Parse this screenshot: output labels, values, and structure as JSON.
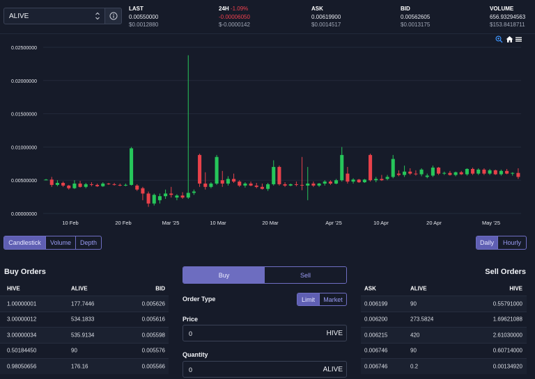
{
  "token": {
    "selected": "ALIVE"
  },
  "stats": [
    {
      "label": "LAST",
      "value": "0.00550000",
      "usd": "$0.0012880"
    },
    {
      "label": "24H",
      "change_pct": "-1.09%",
      "value": "-0.00006050",
      "usd": "$-0.0000142"
    },
    {
      "label": "ASK",
      "value": "0.00619900",
      "usd": "$0.0014517"
    },
    {
      "label": "BID",
      "value": "0.00562605",
      "usd": "$0.0013175"
    },
    {
      "label": "VOLUME",
      "value": "656.93294563",
      "usd": "$153.8418711"
    }
  ],
  "chart_data": {
    "type": "candlestick",
    "y_ticks": [
      "0.02500000",
      "0.02000000",
      "0.01500000",
      "0.01000000",
      "0.00500000",
      "0.00000000"
    ],
    "ylim": [
      0,
      0.025
    ],
    "x_ticks": [
      "10 Feb",
      "20 Feb",
      "Mar '25",
      "10 Mar",
      "20 Mar",
      "Apr '25",
      "10 Apr",
      "20 Apr",
      "May '25"
    ],
    "colors": {
      "up": "#26c65a",
      "down": "#e8414a"
    },
    "candles": [
      [
        0.005,
        0.0052,
        0.005,
        0.0051
      ],
      [
        0.0051,
        0.0055,
        0.004,
        0.0043
      ],
      [
        0.0043,
        0.005,
        0.0041,
        0.0046
      ],
      [
        0.0046,
        0.0048,
        0.004,
        0.0042
      ],
      [
        0.0042,
        0.0043,
        0.0036,
        0.0038
      ],
      [
        0.0038,
        0.005,
        0.0037,
        0.0045
      ],
      [
        0.0045,
        0.0049,
        0.0039,
        0.004
      ],
      [
        0.004,
        0.0046,
        0.0038,
        0.0044
      ],
      [
        0.0044,
        0.0047,
        0.0041,
        0.0043
      ],
      [
        0.0043,
        0.0045,
        0.004,
        0.0041
      ],
      [
        0.0041,
        0.0047,
        0.004,
        0.0045
      ],
      [
        0.0045,
        0.0046,
        0.0043,
        0.0044
      ],
      [
        0.0044,
        0.0046,
        0.0042,
        0.0043
      ],
      [
        0.0043,
        0.0045,
        0.0041,
        0.0042
      ],
      [
        0.0042,
        0.0045,
        0.0041,
        0.0043
      ],
      [
        0.0043,
        0.01,
        0.0042,
        0.0098
      ],
      [
        0.0042,
        0.0044,
        0.0034,
        0.0036
      ],
      [
        0.0038,
        0.004,
        0.002,
        0.003
      ],
      [
        0.003,
        0.0033,
        0.001,
        0.0015
      ],
      [
        0.0015,
        0.003,
        0.0012,
        0.0028
      ],
      [
        0.002,
        0.003,
        0.0015,
        0.0026
      ],
      [
        0.0026,
        0.0036,
        0.0022,
        0.003
      ],
      [
        0.003,
        0.004,
        0.0024,
        0.0028
      ],
      [
        0.0024,
        0.0029,
        0.002,
        0.0027
      ],
      [
        0.0027,
        0.0032,
        0.0022,
        0.0024
      ],
      [
        0.0024,
        0.0238,
        0.0022,
        0.0031
      ],
      [
        0.0031,
        0.0036,
        0.0028,
        0.0033
      ],
      [
        0.0088,
        0.009,
        0.004,
        0.0045
      ],
      [
        0.0045,
        0.0062,
        0.0036,
        0.004
      ],
      [
        0.004,
        0.0047,
        0.0038,
        0.0045
      ],
      [
        0.0045,
        0.0088,
        0.0043,
        0.0085
      ],
      [
        0.005,
        0.0064,
        0.004,
        0.0045
      ],
      [
        0.0045,
        0.0056,
        0.0042,
        0.0052
      ],
      [
        0.0052,
        0.006,
        0.0046,
        0.0048
      ],
      [
        0.0048,
        0.005,
        0.004,
        0.0042
      ],
      [
        0.0042,
        0.0047,
        0.0039,
        0.0045
      ],
      [
        0.0045,
        0.0048,
        0.0041,
        0.0042
      ],
      [
        0.0042,
        0.0046,
        0.0038,
        0.004
      ],
      [
        0.004,
        0.0045,
        0.0036,
        0.0037
      ],
      [
        0.0037,
        0.0046,
        0.0034,
        0.0044
      ],
      [
        0.0044,
        0.008,
        0.0042,
        0.007
      ],
      [
        0.007,
        0.0072,
        0.0042,
        0.0044
      ],
      [
        0.0044,
        0.0047,
        0.004,
        0.0042
      ],
      [
        0.0042,
        0.0045,
        0.0041,
        0.0044
      ],
      [
        0.0044,
        0.0048,
        0.0041,
        0.0043
      ],
      [
        0.0043,
        0.0085,
        0.0035,
        0.0042
      ],
      [
        0.0042,
        0.007,
        0.002,
        0.0045
      ],
      [
        0.0045,
        0.0048,
        0.004,
        0.0042
      ],
      [
        0.0042,
        0.0046,
        0.004,
        0.0045
      ],
      [
        0.0045,
        0.005,
        0.0042,
        0.0048
      ],
      [
        0.0048,
        0.005,
        0.0043,
        0.0045
      ],
      [
        0.0045,
        0.0052,
        0.0044,
        0.005
      ],
      [
        0.005,
        0.01,
        0.0048,
        0.0088
      ],
      [
        0.006,
        0.007,
        0.0045,
        0.0048
      ],
      [
        0.0048,
        0.0053,
        0.0045,
        0.0051
      ],
      [
        0.0051,
        0.0052,
        0.0046,
        0.0047
      ],
      [
        0.0047,
        0.0052,
        0.0046,
        0.0051
      ],
      [
        0.0088,
        0.009,
        0.0048,
        0.005
      ],
      [
        0.005,
        0.0055,
        0.0047,
        0.0052
      ],
      [
        0.0052,
        0.0058,
        0.0049,
        0.005
      ],
      [
        0.0052,
        0.0058,
        0.005,
        0.0055
      ],
      [
        0.0055,
        0.0088,
        0.0053,
        0.0082
      ],
      [
        0.006,
        0.0065,
        0.0056,
        0.0058
      ],
      [
        0.0058,
        0.0072,
        0.0055,
        0.0063
      ],
      [
        0.0063,
        0.0068,
        0.0058,
        0.006
      ],
      [
        0.006,
        0.0065,
        0.0057,
        0.0059
      ],
      [
        0.0059,
        0.0068,
        0.0056,
        0.0066
      ],
      [
        0.0055,
        0.006,
        0.0053,
        0.0057
      ],
      [
        0.0057,
        0.0072,
        0.0055,
        0.0069
      ],
      [
        0.0069,
        0.007,
        0.0058,
        0.006
      ],
      [
        0.006,
        0.0063,
        0.0058,
        0.0061
      ],
      [
        0.0061,
        0.0064,
        0.0057,
        0.0058
      ],
      [
        0.0058,
        0.0063,
        0.0056,
        0.0062
      ],
      [
        0.0062,
        0.0064,
        0.0058,
        0.0059
      ],
      [
        0.0059,
        0.0068,
        0.0057,
        0.0067
      ],
      [
        0.0067,
        0.0069,
        0.0058,
        0.006
      ],
      [
        0.006,
        0.0068,
        0.0058,
        0.0066
      ],
      [
        0.0066,
        0.0068,
        0.0058,
        0.006
      ],
      [
        0.006,
        0.0067,
        0.0058,
        0.0065
      ],
      [
        0.0065,
        0.0066,
        0.0058,
        0.0059
      ],
      [
        0.0059,
        0.0066,
        0.0057,
        0.0064
      ],
      [
        0.0064,
        0.0067,
        0.0059,
        0.006
      ],
      [
        0.006,
        0.0062,
        0.0057,
        0.0061
      ],
      [
        0.0061,
        0.0068,
        0.0052,
        0.0055
      ]
    ]
  },
  "toolbar": {
    "zoom_icon": "zoom-in-icon",
    "home_icon": "home-icon",
    "menu_icon": "hamburger-menu-icon"
  },
  "chart_modes": [
    "Candlestick",
    "Volume",
    "Depth"
  ],
  "intervals": [
    "Daily",
    "Hourly"
  ],
  "buy_orders": {
    "title": "Buy Orders",
    "headers": [
      "HIVE",
      "ALIVE",
      "BID"
    ],
    "rows": [
      [
        "1.00000001",
        "177.7446",
        "0.005626"
      ],
      [
        "3.00000012",
        "534.1833",
        "0.005616"
      ],
      [
        "3.00000034",
        "535.9134",
        "0.005598"
      ],
      [
        "0.50184450",
        "90",
        "0.005576"
      ],
      [
        "0.98050656",
        "176.16",
        "0.005566"
      ]
    ]
  },
  "sell_orders": {
    "title": "Sell Orders",
    "headers": [
      "ASK",
      "ALIVE",
      "HIVE"
    ],
    "rows": [
      [
        "0.006199",
        "90",
        "0.55791000"
      ],
      [
        "0.006200",
        "273.5824",
        "1.69621088"
      ],
      [
        "0.006215",
        "420",
        "2.61030000"
      ],
      [
        "0.006746",
        "90",
        "0.60714000"
      ],
      [
        "0.006746",
        "0.2",
        "0.00134920"
      ]
    ]
  },
  "order_form": {
    "buy_label": "Buy",
    "sell_label": "Sell",
    "order_type_label": "Order Type",
    "order_types": [
      "Limit",
      "Market"
    ],
    "price_label": "Price",
    "price_value": "0",
    "price_unit": "HIVE",
    "quantity_label": "Quantity",
    "quantity_value": "0",
    "quantity_unit": "ALIVE"
  }
}
